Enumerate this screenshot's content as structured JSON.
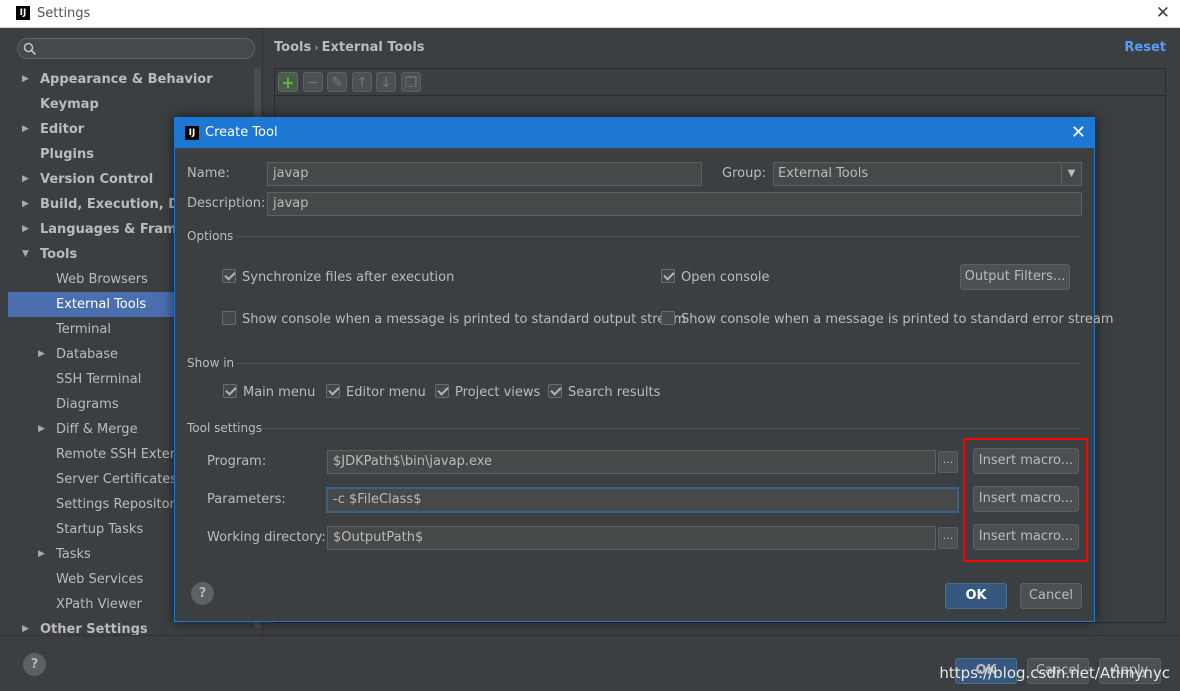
{
  "window": {
    "title": "Settings",
    "logo": "IJ"
  },
  "sidebar": {
    "items": [
      {
        "label": "Appearance & Behavior",
        "level": 0,
        "arrow": "right",
        "bold": true
      },
      {
        "label": "Keymap",
        "level": 0,
        "arrow": "",
        "bold": true
      },
      {
        "label": "Editor",
        "level": 0,
        "arrow": "right",
        "bold": true
      },
      {
        "label": "Plugins",
        "level": 0,
        "arrow": "",
        "bold": true
      },
      {
        "label": "Version Control",
        "level": 0,
        "arrow": "right",
        "bold": true
      },
      {
        "label": "Build, Execution, Depl",
        "level": 0,
        "arrow": "right",
        "bold": true
      },
      {
        "label": "Languages & Framew",
        "level": 0,
        "arrow": "right",
        "bold": true
      },
      {
        "label": "Tools",
        "level": 0,
        "arrow": "down",
        "bold": true
      },
      {
        "label": "Web Browsers",
        "level": 1,
        "arrow": ""
      },
      {
        "label": "External Tools",
        "level": 1,
        "arrow": "",
        "selected": true
      },
      {
        "label": "Terminal",
        "level": 1,
        "arrow": ""
      },
      {
        "label": "Database",
        "level": 1,
        "arrow": "right"
      },
      {
        "label": "SSH Terminal",
        "level": 1,
        "arrow": ""
      },
      {
        "label": "Diagrams",
        "level": 1,
        "arrow": ""
      },
      {
        "label": "Diff & Merge",
        "level": 1,
        "arrow": "right"
      },
      {
        "label": "Remote SSH Externa",
        "level": 1,
        "arrow": ""
      },
      {
        "label": "Server Certificates",
        "level": 1,
        "arrow": ""
      },
      {
        "label": "Settings Repository",
        "level": 1,
        "arrow": ""
      },
      {
        "label": "Startup Tasks",
        "level": 1,
        "arrow": ""
      },
      {
        "label": "Tasks",
        "level": 1,
        "arrow": "right"
      },
      {
        "label": "Web Services",
        "level": 1,
        "arrow": ""
      },
      {
        "label": "XPath Viewer",
        "level": 1,
        "arrow": ""
      },
      {
        "label": "Other Settings",
        "level": 0,
        "arrow": "right",
        "bold": true
      }
    ]
  },
  "main": {
    "breadcrumb": {
      "parent": "Tools",
      "separator": "›",
      "current": "External Tools"
    },
    "reset_label": "Reset"
  },
  "footer": {
    "help": "?",
    "ok_label": "OK",
    "cancel_label": "Cancel",
    "apply_label": "Apply"
  },
  "watermark": "https://blog.csdn.net/Atimynyc",
  "dialog": {
    "title": "Create Tool",
    "logo": "IJ",
    "name_label": "Name:",
    "name_value": "javap",
    "group_label": "Group:",
    "group_value": "External Tools",
    "description_label": "Description:",
    "description_value": "javap",
    "options": {
      "section": "Options",
      "sync_files": "Synchronize files after execution",
      "open_console": "Open console",
      "output_filters": "Output Filters...",
      "show_console_stdout": "Show console when a message is printed to standard output stream",
      "show_console_stderr": "Show console when a message is printed to standard error stream"
    },
    "show_in": {
      "section": "Show in",
      "main_menu": "Main menu",
      "editor_menu": "Editor menu",
      "project_views": "Project views",
      "search_results": "Search results"
    },
    "tool_settings": {
      "section": "Tool settings",
      "program_label": "Program:",
      "program_value": "$JDKPath$\\bin\\javap.exe",
      "parameters_label": "Parameters:",
      "parameters_value": "-c $FileClass$",
      "working_dir_label": "Working directory:",
      "working_dir_value": "$OutputPath$",
      "insert_macro": "Insert macro...",
      "browse": "..."
    },
    "help": "?",
    "ok_label": "OK",
    "cancel_label": "Cancel"
  }
}
